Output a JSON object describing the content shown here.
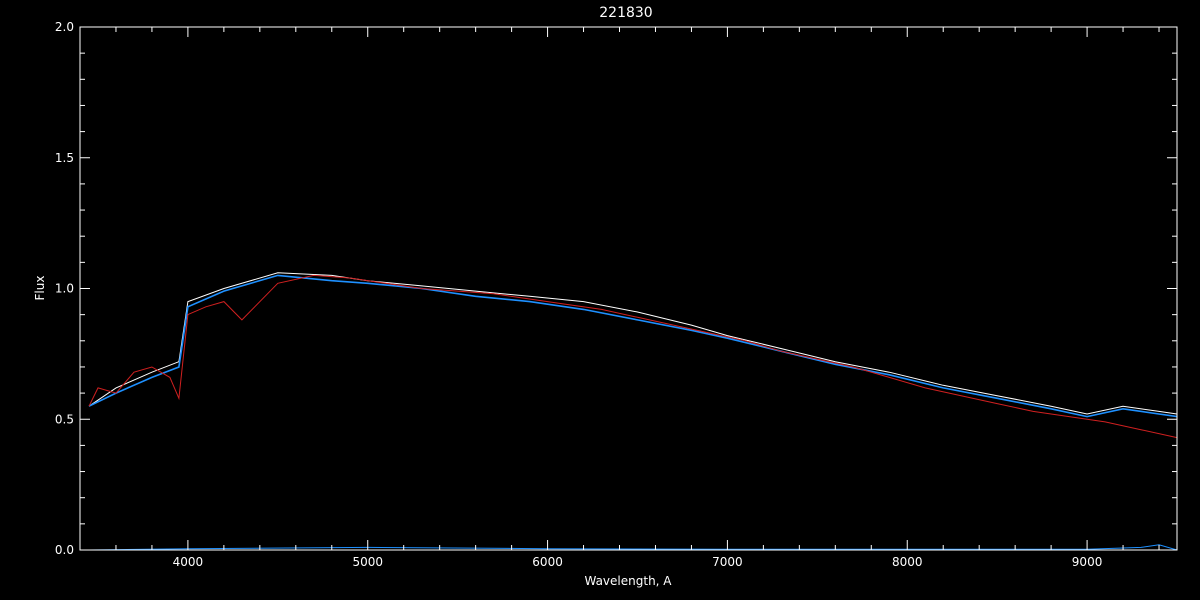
{
  "chart_data": {
    "type": "line",
    "title": "221830",
    "xlabel": "Wavelength, A",
    "ylabel": "Flux",
    "xlim": [
      3400,
      9500
    ],
    "ylim": [
      0.0,
      2.0
    ],
    "x_ticks": [
      4000,
      5000,
      6000,
      7000,
      8000,
      9000
    ],
    "x_tick_labels": [
      "4000",
      "5000",
      "6000",
      "7000",
      "8000",
      "9000"
    ],
    "y_ticks": [
      0.0,
      0.5,
      1.0,
      1.5,
      2.0
    ],
    "y_tick_labels": [
      "0.0",
      "0.5",
      "1.0",
      "1.5",
      "2.0"
    ],
    "grid": false,
    "background": "#000000",
    "axis_color": "#ffffff",
    "series": [
      {
        "color": "#ffffff",
        "x": [
          3450,
          3600,
          3800,
          3950,
          4000,
          4200,
          4500,
          4800,
          5000,
          5300,
          5600,
          5900,
          6200,
          6500,
          6800,
          7000,
          7300,
          7600,
          7900,
          8200,
          8500,
          8800,
          9000,
          9200,
          9400,
          9500
        ],
        "y": [
          0.55,
          0.62,
          0.68,
          0.72,
          0.95,
          1.0,
          1.06,
          1.05,
          1.03,
          1.01,
          0.99,
          0.97,
          0.95,
          0.91,
          0.86,
          0.82,
          0.77,
          0.72,
          0.68,
          0.63,
          0.59,
          0.55,
          0.52,
          0.55,
          0.53,
          0.52
        ]
      },
      {
        "color": "#1e90ff",
        "x": [
          3450,
          3600,
          3800,
          3950,
          4000,
          4200,
          4500,
          4800,
          5000,
          5300,
          5600,
          5900,
          6200,
          6500,
          6800,
          7000,
          7300,
          7600,
          7900,
          8200,
          8500,
          8800,
          9000,
          9200,
          9400,
          9500
        ],
        "y": [
          0.55,
          0.6,
          0.66,
          0.7,
          0.93,
          0.99,
          1.05,
          1.03,
          1.02,
          1.0,
          0.97,
          0.95,
          0.92,
          0.88,
          0.84,
          0.81,
          0.76,
          0.71,
          0.67,
          0.62,
          0.58,
          0.54,
          0.51,
          0.54,
          0.52,
          0.51
        ]
      },
      {
        "color": "#d02020",
        "x": [
          3450,
          3500,
          3600,
          3700,
          3800,
          3900,
          3950,
          4000,
          4100,
          4200,
          4300,
          4500,
          4700,
          4900,
          5100,
          5300,
          5500,
          5700,
          5900,
          6100,
          6300,
          6500,
          6700,
          6900,
          7100,
          7300,
          7500,
          7700,
          7900,
          8100,
          8300,
          8500,
          8700,
          8900,
          9000,
          9100,
          9300,
          9500
        ],
        "y": [
          0.55,
          0.62,
          0.6,
          0.68,
          0.7,
          0.66,
          0.58,
          0.9,
          0.93,
          0.95,
          0.88,
          1.02,
          1.05,
          1.04,
          1.02,
          1.0,
          0.99,
          0.98,
          0.96,
          0.94,
          0.92,
          0.89,
          0.86,
          0.83,
          0.8,
          0.76,
          0.73,
          0.7,
          0.66,
          0.62,
          0.59,
          0.56,
          0.53,
          0.51,
          0.5,
          0.49,
          0.46,
          0.43
        ]
      },
      {
        "color": "#1e90ff",
        "x": [
          3450,
          4000,
          5000,
          6000,
          7000,
          8000,
          9000,
          9300,
          9400,
          9500
        ],
        "y": [
          0.0,
          0.005,
          0.01,
          0.005,
          0.003,
          0.003,
          0.003,
          0.01,
          0.02,
          0.0
        ]
      }
    ]
  }
}
